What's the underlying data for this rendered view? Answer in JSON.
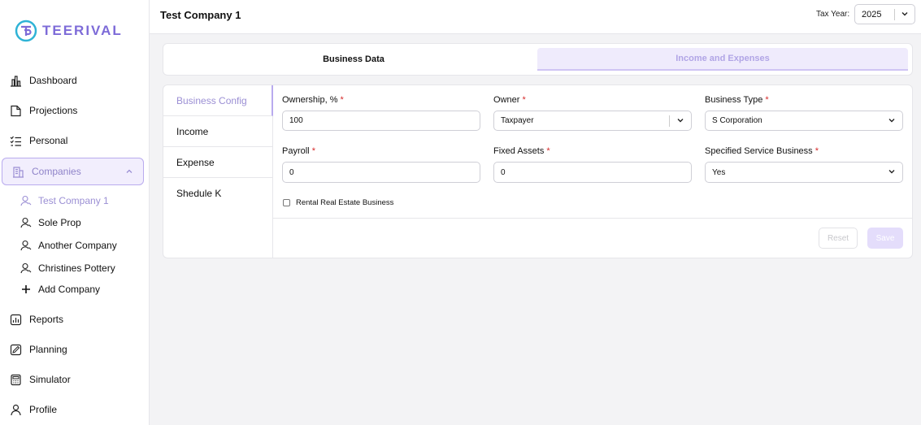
{
  "brand": {
    "name": "TEERIVAL",
    "accent": "#7d6bd8"
  },
  "sidebar": {
    "items": [
      {
        "label": "Dashboard",
        "icon": "chart-bars-icon"
      },
      {
        "label": "Projections",
        "icon": "document-icon"
      },
      {
        "label": "Personal",
        "icon": "checklist-icon"
      },
      {
        "label": "Companies",
        "icon": "building-icon"
      },
      {
        "label": "Reports",
        "icon": "report-chart-icon"
      },
      {
        "label": "Planning",
        "icon": "planning-pencil-icon"
      },
      {
        "label": "Simulator",
        "icon": "calculator-icon"
      },
      {
        "label": "Profile",
        "icon": "user-icon"
      }
    ],
    "companies": [
      {
        "label": "Test Company 1",
        "active": true
      },
      {
        "label": "Sole Prop"
      },
      {
        "label": "Another Company"
      },
      {
        "label": "Christines Pottery"
      }
    ],
    "add_company": "Add Company"
  },
  "header": {
    "title": "Test Company 1",
    "tax_year_label": "Tax Year:",
    "tax_year_value": "2025"
  },
  "tabs": [
    {
      "label": "Business Data",
      "active": true
    },
    {
      "label": "Income and Expenses",
      "active": false
    }
  ],
  "side_tabs": [
    {
      "label": "Business Config",
      "active": true
    },
    {
      "label": "Income"
    },
    {
      "label": "Expense"
    },
    {
      "label": "Shedule K"
    }
  ],
  "form": {
    "ownership": {
      "label": "Ownership, %",
      "value": "100"
    },
    "owner": {
      "label": "Owner",
      "value": "Taxpayer"
    },
    "business_type": {
      "label": "Business Type",
      "value": "S Corporation"
    },
    "payroll": {
      "label": "Payroll",
      "value": "0"
    },
    "fixed_assets": {
      "label": "Fixed Assets",
      "value": "0"
    },
    "specified_service": {
      "label": "Specified Service Business",
      "value": "Yes"
    },
    "rental_label": "Rental Real Estate Business",
    "required_mark": "*"
  },
  "actions": {
    "reset": "Reset",
    "save": "Save"
  }
}
